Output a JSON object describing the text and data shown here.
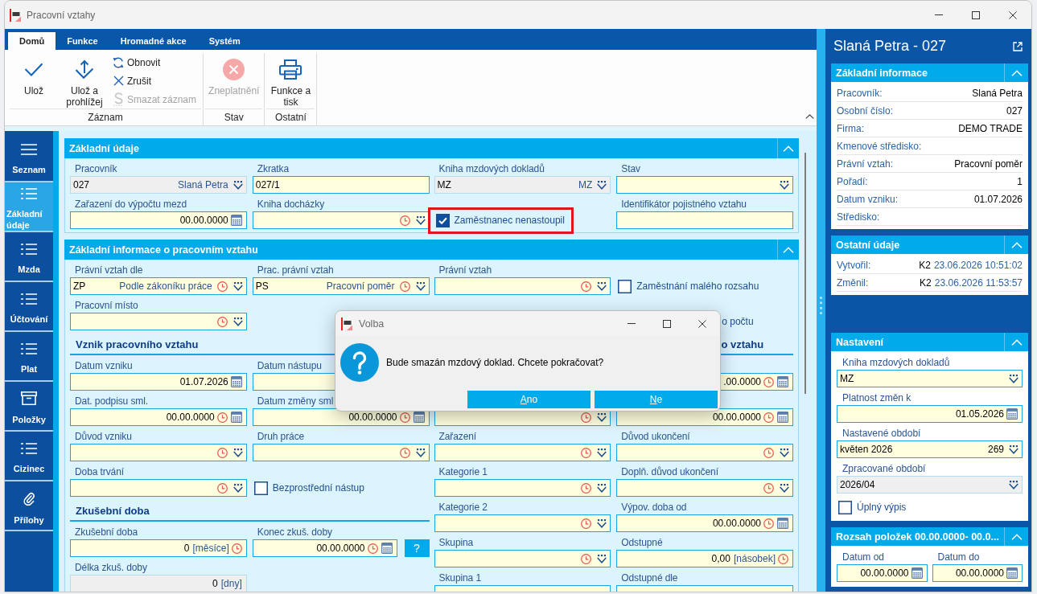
{
  "window": {
    "title": "Pracovní vztahy"
  },
  "ribbon": {
    "tabs": [
      {
        "label": "Domů",
        "selected": true
      },
      {
        "label": "Funkce",
        "selected": false
      },
      {
        "label": "Hromadné akce",
        "selected": false
      },
      {
        "label": "Systém",
        "selected": false
      }
    ],
    "groups": [
      {
        "label": "Záznam",
        "buttons": [
          {
            "kind": "large",
            "label": "Ulož",
            "disabled": false
          },
          {
            "kind": "large",
            "label": "Ulož a prohlížej",
            "disabled": false
          },
          {
            "kind": "small",
            "label": "Obnovit",
            "disabled": false
          },
          {
            "kind": "small",
            "label": "Zrušit",
            "disabled": false
          },
          {
            "kind": "small",
            "label": "Smazat záznam",
            "disabled": true
          }
        ]
      },
      {
        "label": "Stav",
        "buttons": [
          {
            "kind": "large",
            "label": "Zneplatnění",
            "disabled": true
          }
        ]
      },
      {
        "label": "Ostatní",
        "buttons": [
          {
            "kind": "large",
            "label": "Funkce a tisk",
            "disabled": false
          }
        ]
      }
    ]
  },
  "nav": {
    "items": [
      {
        "label": "Seznam",
        "selected": false
      },
      {
        "label": "Základní údaje",
        "selected": true
      },
      {
        "label": "Mzda",
        "selected": false
      },
      {
        "label": "Účtování",
        "selected": false
      },
      {
        "label": "Plat",
        "selected": false
      },
      {
        "label": "Položky",
        "selected": false
      },
      {
        "label": "Cizinec",
        "selected": false
      },
      {
        "label": "Přílohy",
        "selected": false
      }
    ]
  },
  "form": {
    "sections": [
      {
        "title": "Základní údaje",
        "expanded": true,
        "halves": [
          {
            "rows": [
              {
                "kind": "fields",
                "left": {
                  "kind": "select",
                  "label": "Pracovník",
                  "value": "027",
                  "description": "Slaná Petra",
                  "readonly": true
                },
                "right": {
                  "kind": "text",
                  "label": "Zkratka",
                  "value": "027/1",
                  "readonly": false
                }
              },
              {
                "kind": "fields",
                "left": {
                  "kind": "date",
                  "label": "Zařazení do výpočtu mezd",
                  "value": "00.00.0000",
                  "readonly": false
                },
                "right": {
                  "kind": "timedselect",
                  "label": "Kniha docházky",
                  "readonly": false
                }
              }
            ]
          },
          {
            "rows": [
              {
                "kind": "fields",
                "left": {
                  "kind": "select",
                  "label": "Kniha mzdových dokladů",
                  "value": "MZ",
                  "description": "MZ",
                  "readonly": true
                },
                "right": {
                  "kind": "select",
                  "label": "Stav",
                  "readonly": false
                }
              },
              {
                "kind": "fields",
                "left": {
                  "kind": "checkbox",
                  "label": "Zaměstnanec nenastoupil",
                  "checked": true,
                  "highlighted": true
                },
                "right": {
                  "kind": "text",
                  "label": "Identifikátor pojistného vztahu",
                  "readonly": false
                }
              }
            ]
          }
        ]
      },
      {
        "title": "Základní informace o pracovním vztahu",
        "expanded": true,
        "halves": [
          {
            "rows": [
              {
                "kind": "fields",
                "left": {
                  "kind": "timedselect",
                  "label": "Právní vztah dle",
                  "value": "ZP",
                  "description": "Podle zákoníku práce",
                  "readonly": false
                },
                "right": {
                  "kind": "timedselect",
                  "label": "Prac. právní vztah",
                  "value": "PS",
                  "description": "Pracovní poměr",
                  "readonly": false
                }
              },
              {
                "kind": "fields",
                "left": {
                  "kind": "timedselect",
                  "label": "Pracovní místo",
                  "readonly": false
                }
              },
              {
                "kind": "heading",
                "text": "Vznik pracovního vztahu"
              },
              {
                "kind": "fields",
                "left": {
                  "kind": "date",
                  "label": "Datum vzniku",
                  "value": "01.07.2026",
                  "readonly": false
                },
                "right": {
                  "kind": "text",
                  "label": "Datum nástupu",
                  "readonly": false
                }
              },
              {
                "kind": "fields",
                "left": {
                  "kind": "timeddate",
                  "label": "Dat. podpisu sml.",
                  "value": "00.00.0000",
                  "readonly": false
                },
                "right": {
                  "kind": "timeddate",
                  "label": "Datum změny sml",
                  "value": "00.00.0000",
                  "readonly": false
                }
              },
              {
                "kind": "fields",
                "left": {
                  "kind": "timedselect",
                  "label": "Důvod vzniku",
                  "readonly": false
                },
                "right": {
                  "kind": "timedselect",
                  "label": "Druh práce",
                  "readonly": false
                }
              },
              {
                "kind": "fields",
                "left": {
                  "kind": "timedselect",
                  "label": "Doba trvání",
                  "readonly": false
                },
                "right": {
                  "kind": "checkbox",
                  "label": "Bezprostřední nástup",
                  "checked": false,
                  "highlighted": false
                }
              },
              {
                "kind": "heading",
                "text": "Zkušební doba"
              },
              {
                "kind": "fields",
                "left": {
                  "kind": "timednumber",
                  "label": "Zkušební doba",
                  "value": "0",
                  "unit": "[měsíce]",
                  "readonly": false
                },
                "right": {
                  "kind": "timeddate",
                  "label": "Konec zkuš. doby",
                  "value": "00.00.0000",
                  "readonly": false,
                  "help_button": "?"
                }
              },
              {
                "kind": "fields",
                "left": {
                  "kind": "number",
                  "label": "Délka zkuš. doby",
                  "value": "0",
                  "unit": "[dny]",
                  "readonly": true
                }
              }
            ]
          },
          {
            "rows": [
              {
                "kind": "fields",
                "left": {
                  "kind": "timedselect",
                  "label": "Právní vztah",
                  "readonly": false
                },
                "right": {
                  "kind": "checkbox",
                  "label": "Zaměstnání malého rozsahu",
                  "checked": false,
                  "highlighted": false
                }
              },
              {
                "kind": "fields",
                "right": {
                  "kind": "fragment",
                  "label": "o počtu"
                }
              },
              {
                "kind": "fragment",
                "text": "o vztahu"
              },
              {
                "kind": "fields",
                "right": {
                  "kind": "timeddate",
                  "value": ".00.0000",
                  "readonly": false
                }
              },
              {
                "kind": "fields",
                "left": {
                  "kind": "timedselect",
                  "readonly": false
                },
                "right": {
                  "kind": "timeddate",
                  "value": "00.00.0000",
                  "readonly": false
                }
              },
              {
                "kind": "fields",
                "left": {
                  "kind": "timedselect",
                  "label": "Zařazení",
                  "readonly": false
                },
                "right": {
                  "kind": "timedselect",
                  "label": "Důvod ukončení",
                  "readonly": false
                }
              },
              {
                "kind": "fields",
                "left": {
                  "kind": "timedselect",
                  "label": "Kategorie 1",
                  "readonly": false
                },
                "right": {
                  "kind": "timedselect",
                  "label": "Doplň. důvod ukončení",
                  "readonly": false
                }
              },
              {
                "kind": "fields",
                "left": {
                  "kind": "timedselect",
                  "label": "Kategorie 2",
                  "readonly": false
                },
                "right": {
                  "kind": "timeddate",
                  "label": "Výpov. doba od",
                  "value": "00.00.0000",
                  "readonly": false
                }
              },
              {
                "kind": "fields",
                "left": {
                  "kind": "timedselect",
                  "label": "Skupina",
                  "readonly": false
                },
                "right": {
                  "kind": "timednumber",
                  "label": "Odstupné",
                  "value": "0,00",
                  "unit": "[násobek]",
                  "readonly": false
                }
              },
              {
                "kind": "fields",
                "left": {
                  "kind": "text",
                  "label": "Skupina 1",
                  "readonly": false
                },
                "right": {
                  "kind": "text",
                  "label": "Odstupné dle",
                  "readonly": false
                }
              }
            ]
          }
        ]
      }
    ]
  },
  "detail": {
    "title": "Slaná Petra - 027",
    "sections": [
      {
        "kind": "info",
        "title": "Základní informace",
        "expanded": true,
        "rows": [
          {
            "label": "Pracovník:",
            "value": "Slaná Petra"
          },
          {
            "label": "Osobní číslo:",
            "value": "027"
          },
          {
            "label": "Firma:",
            "value": "DEMO TRADE"
          },
          {
            "label": "Kmenové středisko:"
          },
          {
            "label": "Právní vztah:",
            "value": "Pracovní poměr"
          },
          {
            "label": "Pořadí:",
            "value": "1"
          },
          {
            "label": "Datum vzniku:",
            "value": "01.07.2026"
          },
          {
            "label": "Středisko:"
          }
        ]
      },
      {
        "kind": "info",
        "title": "Ostatní údaje",
        "expanded": true,
        "rows": [
          {
            "label": "Vytvořil:",
            "value": "K2",
            "timestamp": "23.06.2026 10:51:02"
          },
          {
            "label": "Změnil:",
            "value": "K2",
            "timestamp": "23.06.2026 11:53:57"
          }
        ]
      },
      {
        "kind": "form",
        "title": "Nastavení",
        "expanded": true,
        "fields": [
          {
            "kind": "select",
            "label": "Kniha mzdových dokladů",
            "value": "MZ",
            "readonly": false
          },
          {
            "kind": "date",
            "label": "Platnost změn k",
            "value": "01.05.2026",
            "readonly": false
          },
          {
            "kind": "select",
            "label": "Nastavené období",
            "value": "květen 2026",
            "description": "269",
            "readonly": false
          },
          {
            "kind": "select",
            "label": "Zpracované období",
            "value": "2026/04",
            "readonly": true
          },
          {
            "kind": "checkbox",
            "label": "Úplný výpis",
            "checked": false,
            "highlighted": false
          }
        ]
      },
      {
        "kind": "range",
        "title": "Rozsah položek 00.00.0000- 00.0...",
        "expanded": true,
        "fields": [
          {
            "kind": "date",
            "label": "Datum od",
            "value": "00.00.0000",
            "readonly": false
          },
          {
            "kind": "date",
            "label": "Datum do",
            "value": "00.00.0000",
            "readonly": false
          }
        ]
      }
    ]
  },
  "dialog": {
    "title": "Volba",
    "message": "Bude smazán mzdový doklad. Chcete pokračovat?",
    "buttons": [
      "Ano",
      "Ne"
    ]
  }
}
